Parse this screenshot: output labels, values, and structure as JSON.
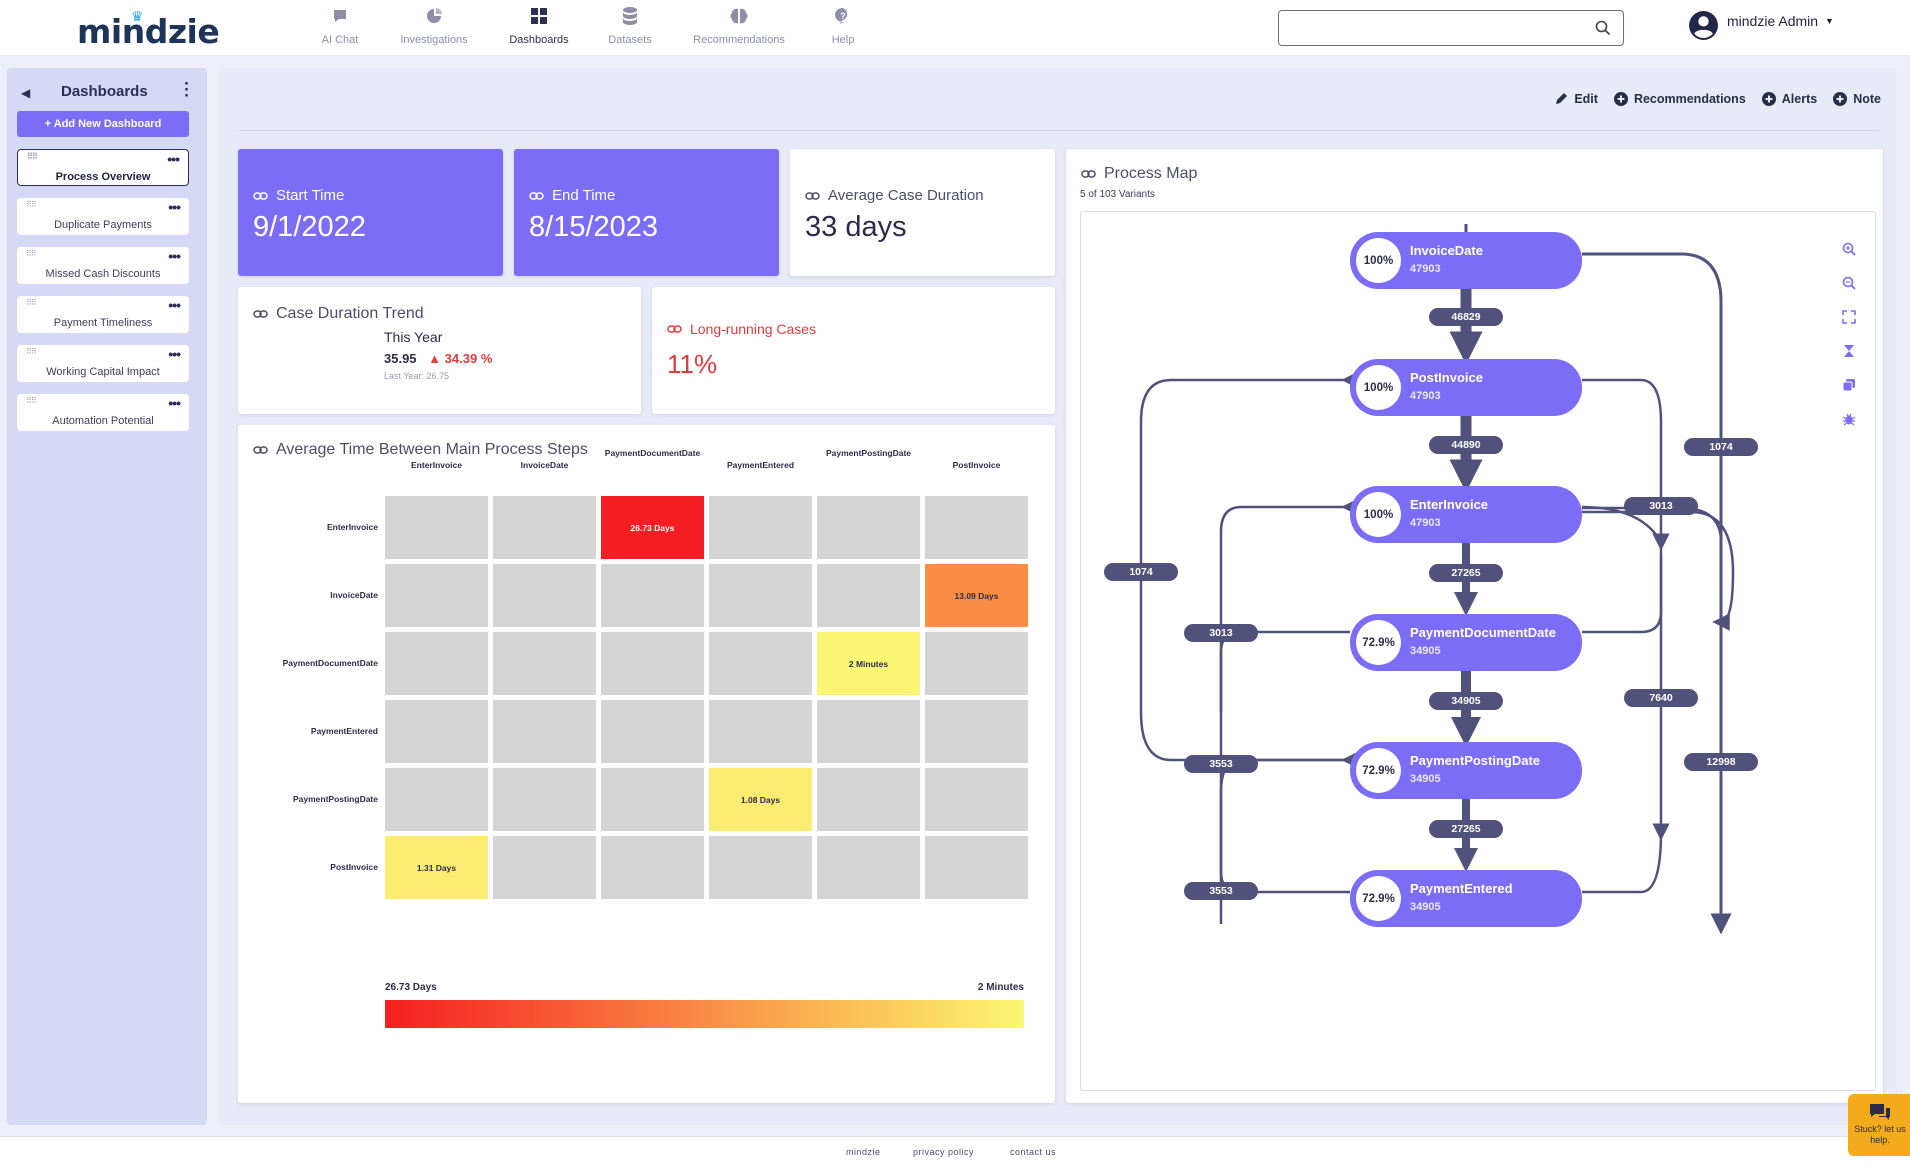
{
  "app": {
    "logo": "mindzie"
  },
  "nav": [
    {
      "label": "AI Chat",
      "icon": "chat-icon"
    },
    {
      "label": "Investigations",
      "icon": "investigation-icon"
    },
    {
      "label": "Dashboards",
      "icon": "dashboard-icon",
      "active": true
    },
    {
      "label": "Datasets",
      "icon": "database-icon"
    },
    {
      "label": "Recommendations",
      "icon": "brain-icon"
    },
    {
      "label": "Help",
      "icon": "help-icon"
    }
  ],
  "search": {
    "placeholder": "",
    "value": ""
  },
  "user": {
    "name": "mindzie Admin"
  },
  "sidebar": {
    "title": "Dashboards",
    "add_label": "+ Add New Dashboard",
    "items": [
      {
        "label": "Process Overview",
        "active": true
      },
      {
        "label": "Duplicate Payments"
      },
      {
        "label": "Missed Cash Discounts"
      },
      {
        "label": "Payment Timeliness"
      },
      {
        "label": "Working Capital Impact"
      },
      {
        "label": "Automation Potential"
      }
    ]
  },
  "toolbar": {
    "edit": "Edit",
    "recommendations": "Recommendations",
    "alerts": "Alerts",
    "note": "Note"
  },
  "kpis": {
    "start": {
      "title": "Start Time",
      "value": "9/1/2022"
    },
    "end": {
      "title": "End Time",
      "value": "8/15/2023"
    },
    "avg": {
      "title": "Average Case Duration",
      "value": "33 days"
    },
    "trend": {
      "title": "Case Duration Trend",
      "subtitle": "This Year",
      "value": "35.95",
      "change": "34.39 %",
      "last_year": "Last Year:  26.75"
    },
    "long": {
      "title": "Long-running Cases",
      "value": "11%"
    }
  },
  "heatmap": {
    "title": "Average Time Between Main Process Steps",
    "columns": [
      "EnterInvoice",
      "InvoiceDate",
      "PaymentDocumentDate",
      "PaymentEntered",
      "PaymentPostingDate",
      "PostInvoice"
    ],
    "rows": [
      "EnterInvoice",
      "InvoiceDate",
      "PaymentDocumentDate",
      "PaymentEntered",
      "PaymentPostingDate",
      "PostInvoice"
    ],
    "cells": [
      {
        "row": 0,
        "col": 2,
        "label": "26.73 Days",
        "color": "#f31d23",
        "text_color": "#ffffff"
      },
      {
        "row": 1,
        "col": 5,
        "label": "13.09 Days",
        "color": "#f98d43",
        "text_color": "#2b2d4a"
      },
      {
        "row": 2,
        "col": 4,
        "label": "2 Minutes",
        "color": "#fbf774",
        "text_color": "#2b2d4a"
      },
      {
        "row": 4,
        "col": 3,
        "label": "1.08 Days",
        "color": "#fcec72",
        "text_color": "#2b2d4a"
      },
      {
        "row": 5,
        "col": 0,
        "label": "1.31 Days",
        "color": "#fcec72",
        "text_color": "#2b2d4a"
      }
    ],
    "scale_min": "26.73 Days",
    "scale_max": "2 Minutes"
  },
  "process_map": {
    "title": "Process Map",
    "subtitle": "5 of 103 Variants",
    "nodes": [
      {
        "name": "InvoiceDate",
        "pct": "100%",
        "count": "47903"
      },
      {
        "name": "PostInvoice",
        "pct": "100%",
        "count": "47903"
      },
      {
        "name": "EnterInvoice",
        "pct": "100%",
        "count": "47903"
      },
      {
        "name": "PaymentDocumentDate",
        "pct": "72.9%",
        "count": "34905"
      },
      {
        "name": "PaymentPostingDate",
        "pct": "72.9%",
        "count": "34905"
      },
      {
        "name": "PaymentEntered",
        "pct": "72.9%",
        "count": "34905"
      }
    ],
    "edges": [
      "46829",
      "44890",
      "27265",
      "34905",
      "27265",
      "1074",
      "3013",
      "7640",
      "12998",
      "1074",
      "3013",
      "3553",
      "3553"
    ]
  },
  "footer": {
    "brand": "mindzie",
    "privacy": "privacy policy",
    "contact": "contact us"
  },
  "help_widget": {
    "text": "Stuck? let us help."
  }
}
